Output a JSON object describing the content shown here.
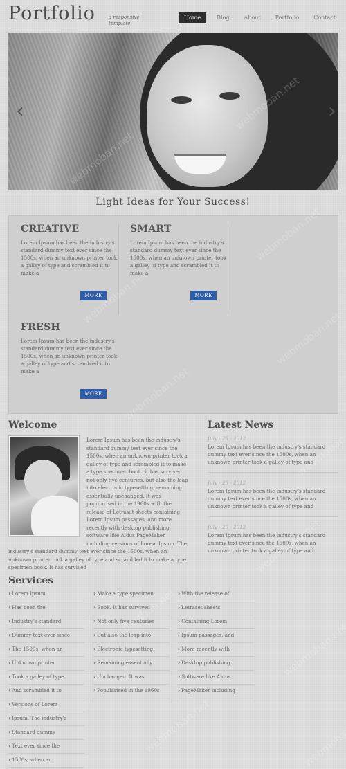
{
  "header": {
    "logo": "Portfolio",
    "tagline": "a responsive template",
    "nav": [
      "Home",
      "Blog",
      "About",
      "Portfolio",
      "Contact"
    ],
    "active_nav": "Home"
  },
  "hero": {
    "prev_icon": "‹",
    "next_icon": "›"
  },
  "tagline_heading": "Light Ideas for Your Success!",
  "features": [
    {
      "title": "CREATIVE",
      "text": "Lorem Ipsum has been the industry's standard dummy text ever since the 1500s, when an unknown printer took a galley of type and scrambled it to make a",
      "more": "MORE"
    },
    {
      "title": "SMART",
      "text": "Lorem Ipsum has been the industry's standard dummy text ever since the 1500s, when an unknown printer took a galley of type and scrambled it to make a",
      "more": "MORE"
    },
    {
      "title": "FRESH",
      "text": "Lorem Ipsum has been the industry's standard dummy text ever since the 1500s, when an unknown printer took a galley of type and scrambled it to make a",
      "more": "MORE"
    }
  ],
  "welcome": {
    "heading": "Welcome",
    "text": "Lorem Ipsum has been the industry's standard dummy text ever since the 1500s, when an unknown printer took a galley of type and scrambled it to make a type specimen book. It has survived not only five centuries, but also the leap into electronic typesetting, remaining essentially unchanged. It was popularised in the 1960s with the release of Letraset sheets containing Lorem Ipsum passages, and more recently with desktop publishing software like Aldus PageMaker including versions of Lorem Ipsum. The industry's standard dummy text ever since the 1500s, when an unknown printer took a galley of type and scrambled it to make a type specimen book. It has survived"
  },
  "news": {
    "heading": "Latest News",
    "items": [
      {
        "date": "July - 25 - 2012",
        "text": "Lorem Ipsum has been the industry's standard dummy text ever since the 1500s, when an unknown printer took a galley of type and"
      },
      {
        "date": "July - 26 - 2012",
        "text": "Lorem Ipsum has been the industry's standard dummy text ever since the 1500s, when an unknown printer took a galley of type and"
      },
      {
        "date": "July - 26 - 2012",
        "text": "Lorem Ipsum has been the industry's standard dummy text ever since the 1500s, when an unknown printer took a galley of type and"
      }
    ]
  },
  "services": {
    "heading": "Services",
    "columns": [
      [
        "Lorem Ipsum",
        "Has been the",
        "Industry's standard",
        "Dummy text ever since",
        "The 1500s, when an",
        "Unknown printer",
        "Took a galley of type",
        "And scrambled it to",
        "Versions of Lorem",
        "Ipsum. The industry's",
        "Standard dummy",
        "Text ever since the",
        "1500s, when an"
      ],
      [
        "Make a type specimen",
        "Book. It has survived",
        "Not only five centuries",
        "But also the leap into",
        "Electronic typesetting,",
        "Remaining essentially",
        "Unchanged. It was",
        "Popularised in the 1960s"
      ],
      [
        "With the release of",
        "Letraset sheets",
        "Containing Lorem",
        "Ipsum passages, and",
        "More recently with",
        "Desktop publishing",
        "Software like Aldus",
        "PageMaker including"
      ]
    ]
  },
  "watermark": "webmoban.net",
  "colors": {
    "accent": "#2f5da8",
    "nav_active_bg": "#2e2e2e",
    "page_bg": "#dedede"
  },
  "icons": {
    "bullet": "chevron-right-icon"
  }
}
